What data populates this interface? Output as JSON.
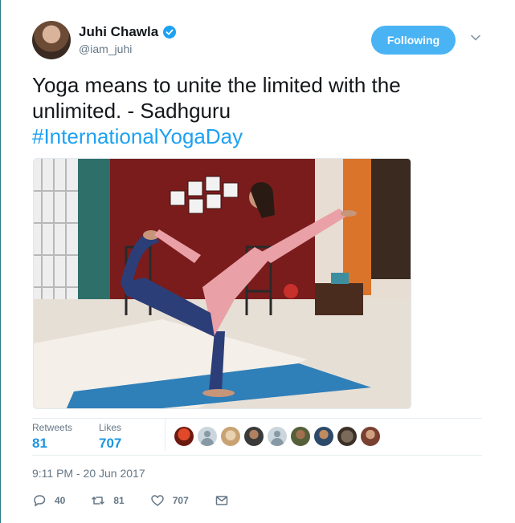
{
  "user": {
    "name": "Juhi Chawla",
    "handle": "@iam_juhi"
  },
  "follow_button": {
    "label": "Following"
  },
  "tweet": {
    "text": "Yoga means to unite the limited with the unlimited. - Sadhguru",
    "hashtag": "#InternationalYogaDay"
  },
  "stats": {
    "retweets_label": "Retweets",
    "retweets_value": "81",
    "likes_label": "Likes",
    "likes_value": "707"
  },
  "timestamp": "9:11 PM - 20 Jun 2017",
  "actions": {
    "reply_count": "40",
    "retweet_count": "81",
    "like_count": "707"
  },
  "colors": {
    "accent": "#1da1f2",
    "follow_button_bg": "#4ab3f4",
    "secondary_text": "#657786"
  },
  "icons": [
    "verified-badge-icon",
    "chevron-down-icon",
    "reply-icon",
    "retweet-icon",
    "heart-icon",
    "envelope-icon"
  ]
}
